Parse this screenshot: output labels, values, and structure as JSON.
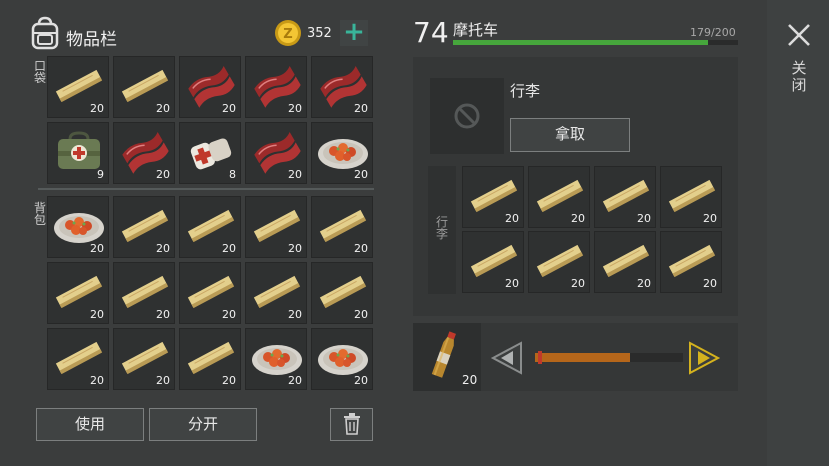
{
  "header": {
    "title": "物品栏",
    "coins": "352",
    "add_coins_symbol": "+"
  },
  "labels": {
    "pockets": "口袋",
    "backpack": "背包",
    "luggage_side": "行李",
    "close": "关闭"
  },
  "pockets": [
    {
      "item": "plank-icon",
      "count": "20"
    },
    {
      "item": "plank-icon",
      "count": "20"
    },
    {
      "item": "raw-meat-icon",
      "count": "20"
    },
    {
      "item": "raw-meat-icon",
      "count": "20"
    },
    {
      "item": "raw-meat-icon",
      "count": "20"
    },
    {
      "item": "medical-bag-icon",
      "count": "9"
    },
    {
      "item": "raw-meat-icon",
      "count": "20"
    },
    {
      "item": "bandage-icon",
      "count": "8"
    },
    {
      "item": "raw-meat-icon",
      "count": "20"
    },
    {
      "item": "food-plate-icon",
      "count": "20"
    }
  ],
  "backpack": [
    {
      "item": "food-plate-icon",
      "count": "20"
    },
    {
      "item": "plank-icon",
      "count": "20"
    },
    {
      "item": "plank-icon",
      "count": "20"
    },
    {
      "item": "plank-icon",
      "count": "20"
    },
    {
      "item": "plank-icon",
      "count": "20"
    },
    {
      "item": "plank-icon",
      "count": "20"
    },
    {
      "item": "plank-icon",
      "count": "20"
    },
    {
      "item": "plank-icon",
      "count": "20"
    },
    {
      "item": "plank-icon",
      "count": "20"
    },
    {
      "item": "plank-icon",
      "count": "20"
    },
    {
      "item": "plank-icon",
      "count": "20"
    },
    {
      "item": "plank-icon",
      "count": "20"
    },
    {
      "item": "plank-icon",
      "count": "20"
    },
    {
      "item": "food-plate-icon",
      "count": "20"
    },
    {
      "item": "food-plate-icon",
      "count": "20"
    }
  ],
  "actions": {
    "use": "使用",
    "split": "分开"
  },
  "vehicle": {
    "level": "74",
    "name": "摩托车",
    "durability": "179/200",
    "durability_fraction": 0.895,
    "durability_color": "#46a63c"
  },
  "luggage": {
    "label": "行李",
    "take_button": "拿取",
    "items": [
      {
        "item": "plank-icon",
        "count": "20"
      },
      {
        "item": "plank-icon",
        "count": "20"
      },
      {
        "item": "plank-icon",
        "count": "20"
      },
      {
        "item": "plank-icon",
        "count": "20"
      },
      {
        "item": "plank-icon",
        "count": "20"
      },
      {
        "item": "plank-icon",
        "count": "20"
      },
      {
        "item": "plank-icon",
        "count": "20"
      },
      {
        "item": "plank-icon",
        "count": "20"
      }
    ]
  },
  "fuel": {
    "item": "fuel-bottle-icon",
    "count": "20",
    "amount_fraction": 0.64,
    "fill_color": "#b5661a",
    "arrow_color": "#d4b21e"
  }
}
